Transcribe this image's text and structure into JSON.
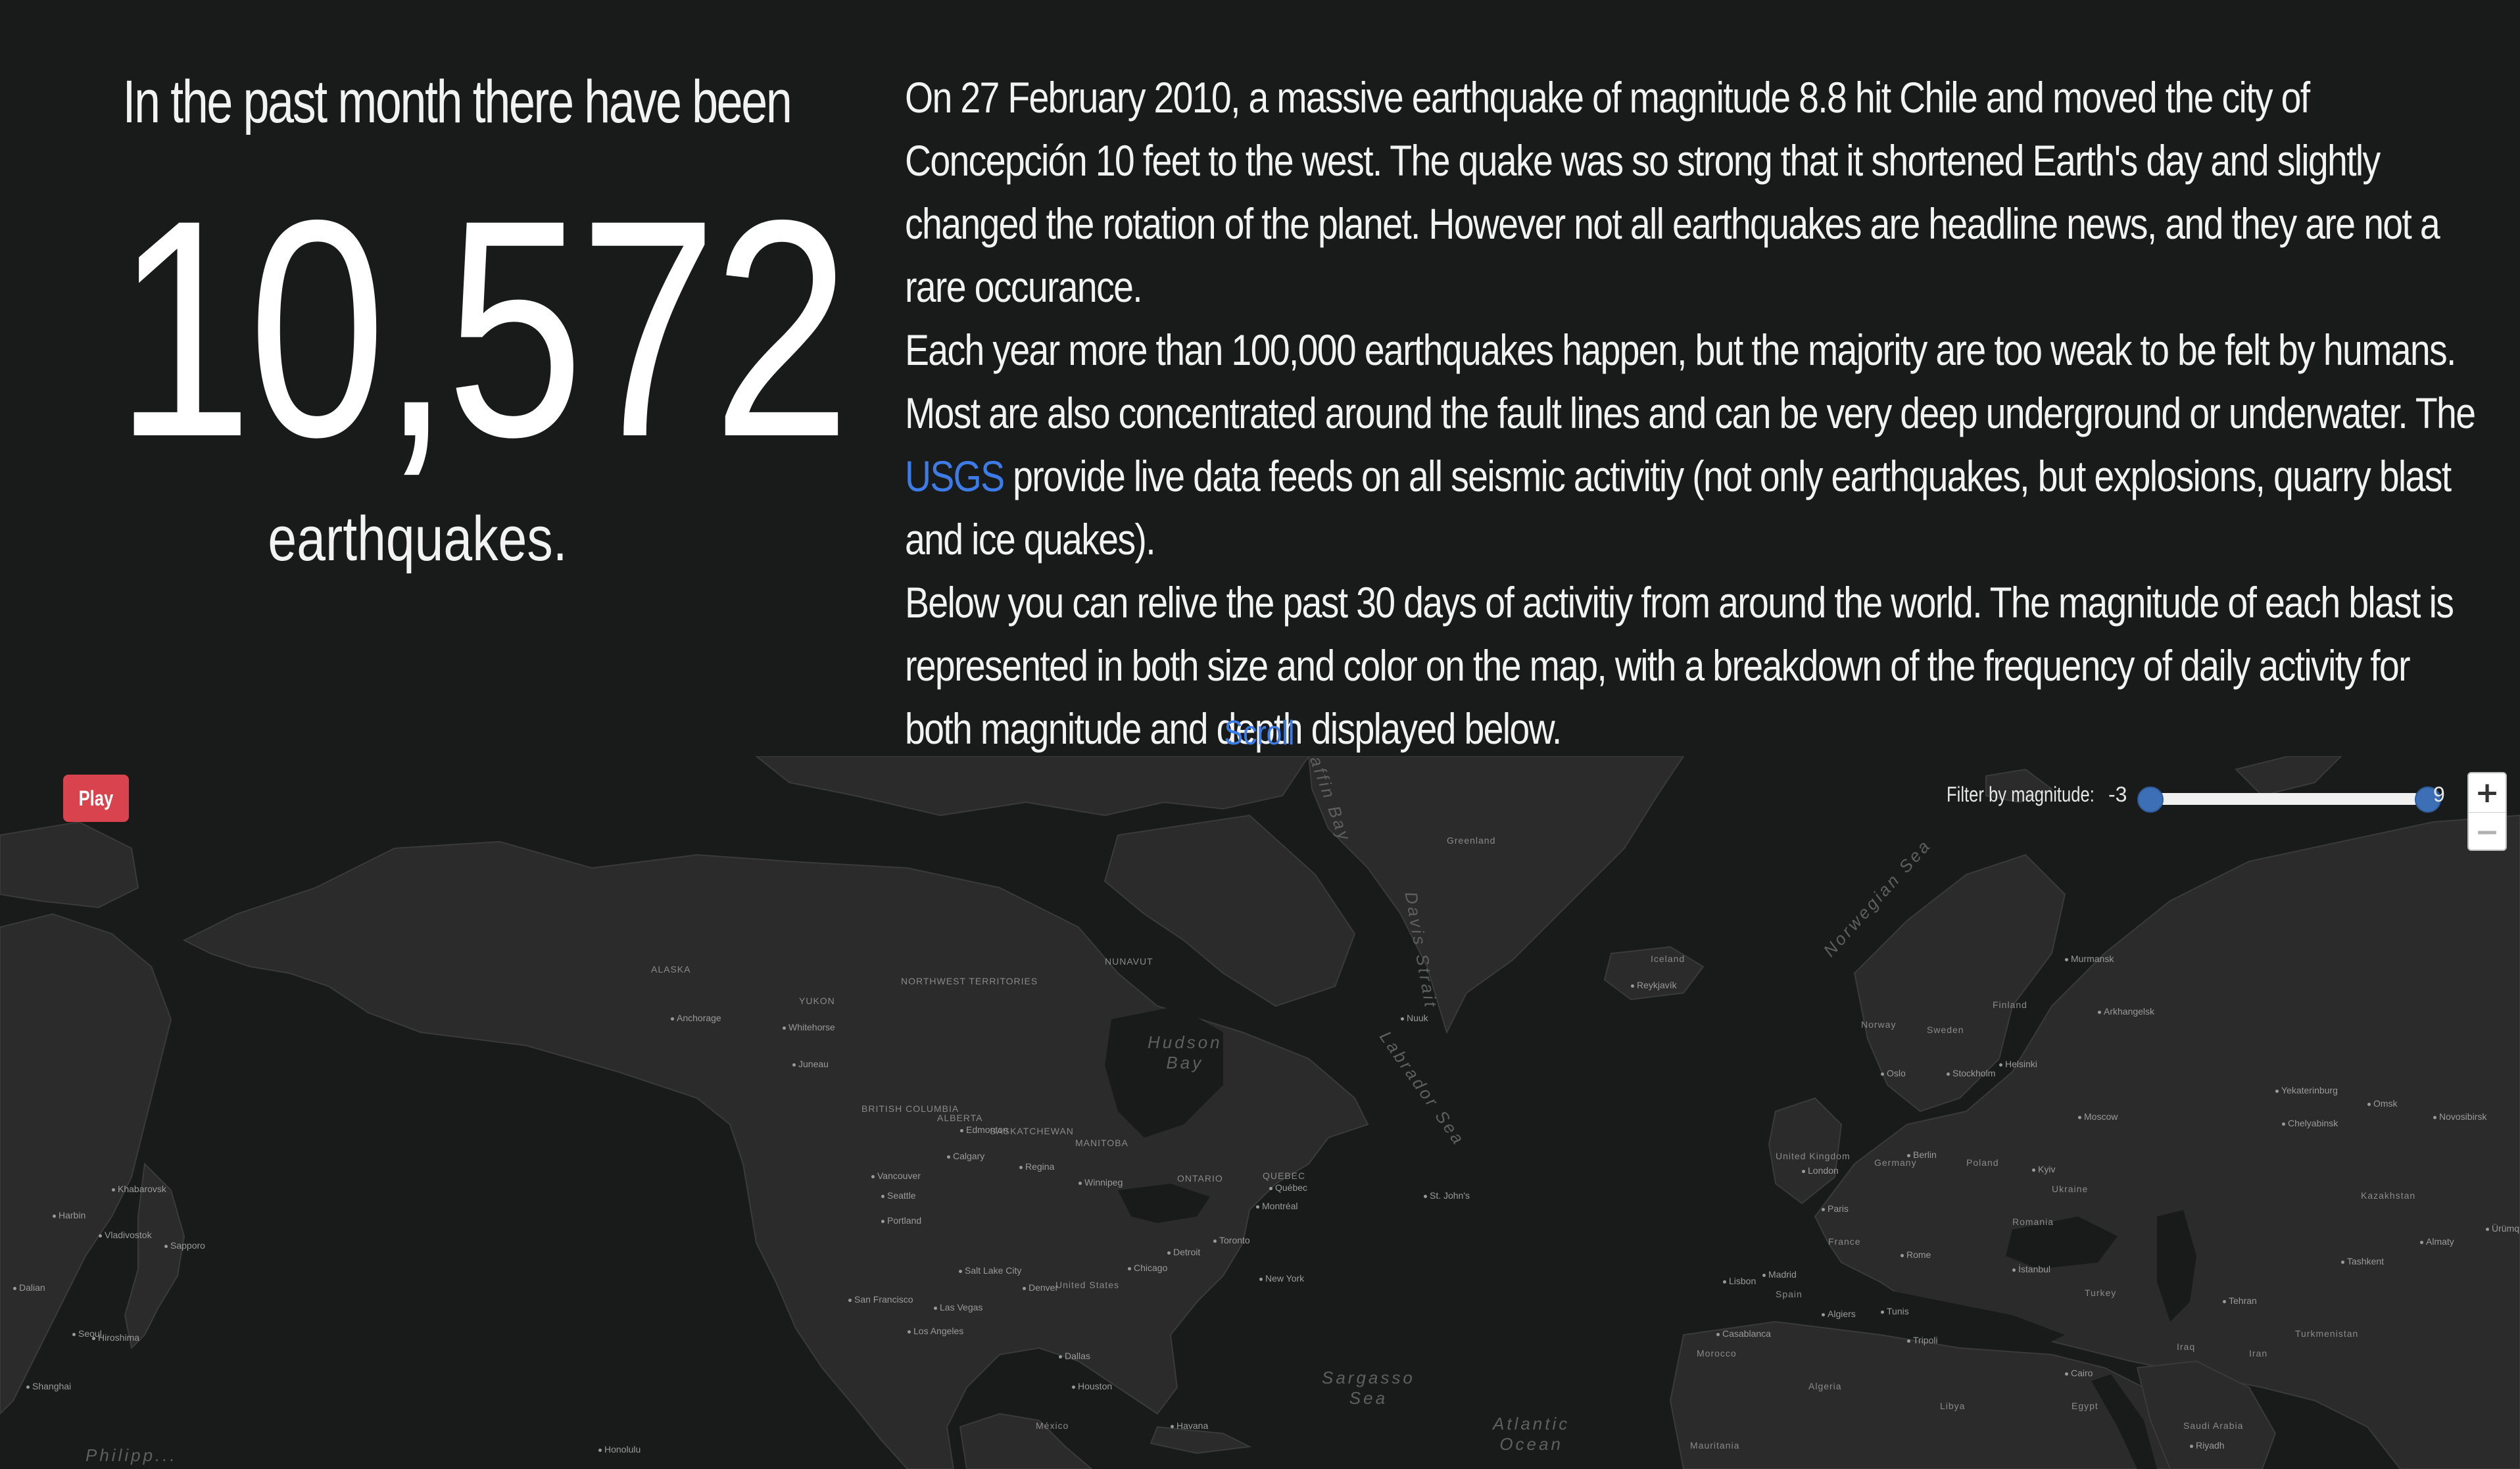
{
  "hero": {
    "intro": "In the past month there have been",
    "count": "10,572",
    "outro": "earthquakes."
  },
  "article": {
    "p1": "On 27 February 2010, a massive earthquake of magnitude 8.8 hit Chile and moved the city of Concepción 10 feet to the west. The quake was so strong that it shortened Earth's day and slightly changed the rotation of the planet. However not all earthquakes are headline news, and they are not a rare occurance.",
    "p2_before_link": "Each year more than 100,000 earthquakes happen, but the majority are too weak to be felt by humans. Most are also concentrated around the fault lines and can be very deep underground or underwater. The ",
    "p2_link": "USGS",
    "p2_after_link": " provide live data feeds on all seismic activitiy (not only earthquakes, but explosions, quarry blast and ice quakes).",
    "p3": "Below you can relive the past 30 days of activitiy from around the world. The magnitude of each blast is represented in both size and color on the map, with a breakdown of the frequency of daily activity for both magnitude and depth displayed below."
  },
  "scroll_down": "Scroll Down",
  "map": {
    "play_label": "Play",
    "filter": {
      "label": "Filter by magnitude:",
      "min": "-3",
      "max": "9"
    },
    "zoom": {
      "in": "+",
      "out": "−"
    },
    "ocean_labels": {
      "atlantic": "Atlantic\nOcean",
      "sargasso": "Sargasso\nSea",
      "hudson": "Hudson\nBay",
      "labrador": "Labrador Sea",
      "norwegian": "Norwegian Sea",
      "baffin": "Baffin Bay",
      "davis": "Davis Strait",
      "philippine": "Philipp..."
    },
    "region_labels": {
      "alaska": "ALASKA",
      "yukon": "YUKON",
      "nwt": "NORTHWEST TERRITORIES",
      "nunavut": "NUNAVUT",
      "bc": "BRITISH COLUMBIA",
      "alberta": "ALBERTA",
      "sask": "SASKATCHEWAN",
      "manitoba": "MANITOBA",
      "ontario": "ONTARIO",
      "quebec": "QUEBEC",
      "us": "United States",
      "mexico": "México",
      "kazakhstan": "Kazakhstan",
      "turkmenistan": "Turkmenistan",
      "algeria": "Algeria",
      "libya": "Libya",
      "egypt": "Egypt",
      "saudi": "Saudi Arabia",
      "iran": "Iran",
      "iraq": "Iraq",
      "turkey": "Turkey",
      "sweden": "Sweden",
      "finland": "Finland",
      "norway": "Norway",
      "uk": "United Kingdom",
      "france": "France",
      "spain": "Spain",
      "germany": "Germany",
      "poland": "Poland",
      "ukraine": "Ukraine",
      "romania": "Romania",
      "morocco": "Morocco",
      "iceland": "Iceland",
      "greenland_ice": "Greenland",
      "mauritania": "Mauritania"
    },
    "cities": {
      "anchorage": "Anchorage",
      "whitehorse": "Whitehorse",
      "juneau": "Juneau",
      "vancouver": "Vancouver",
      "seattle": "Seattle",
      "portland": "Portland",
      "sf": "San Francisco",
      "la": "Los Angeles",
      "lasvegas": "Las Vegas",
      "slc": "Salt Lake City",
      "denver": "Denver",
      "calgary": "Calgary",
      "edmonton": "Edmonton",
      "regina": "Regina",
      "winnipeg": "Winnipeg",
      "chicago": "Chicago",
      "detroit": "Detroit",
      "toronto": "Toronto",
      "montreal": "Montréal",
      "newyork": "New York",
      "quebec_city": "Québec",
      "stjohns": "St. John's",
      "houston": "Houston",
      "dallas": "Dallas",
      "havana": "Havana",
      "honolulu": "Honolulu",
      "london": "London",
      "paris": "Paris",
      "madrid": "Madrid",
      "berlin": "Berlin",
      "rome": "Rome",
      "moscow": "Moscow",
      "istanbul": "İstanbul",
      "kyiv": "Kyiv",
      "stockholm": "Stockholm",
      "helsinki": "Helsinki",
      "oslo": "Oslo",
      "tehran": "Tehran",
      "cairo": "Cairo",
      "riyadh": "Riyadh",
      "tashkent": "Tashkent",
      "almaty": "Almaty",
      "urumqi": "Ürümqi",
      "sapporo": "Sapporo",
      "seoul": "Seoul",
      "shanghai": "Shanghai",
      "dalian": "Dalian",
      "harbin": "Harbin",
      "vladivostok": "Vladivostok",
      "khabarovsk": "Khabarovsk",
      "hiroshima": "Hiroshima",
      "murmansk": "Murmansk",
      "arkhangelsk": "Arkhangelsk",
      "novosibirsk": "Novosibirsk",
      "yekaterinburg": "Yekaterinburg",
      "chelyabinsk": "Chelyabinsk",
      "omsk": "Omsk",
      "reykjavik": "Reykjavík",
      "nuuk": "Nuuk",
      "tripoli": "Tripoli",
      "tunis": "Tunis",
      "algiers": "Algiers",
      "casablanca": "Casablanca",
      "lisbon": "Lisbon"
    }
  }
}
